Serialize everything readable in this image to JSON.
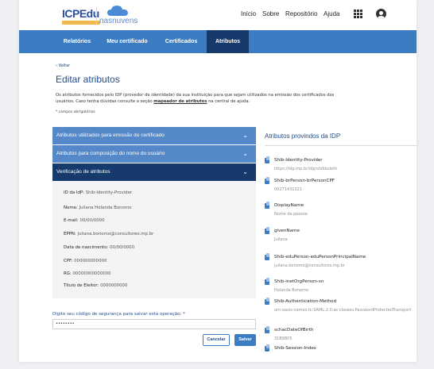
{
  "header": {
    "brand_icp": "ICPEdu",
    "brand_nas": "nasnuvens",
    "nav": [
      "Início",
      "Sobre",
      "Repositório",
      "Ajuda"
    ]
  },
  "mainnav": {
    "tabs": [
      "Relatórios",
      "Meu certificado",
      "Certificados",
      "Atributos"
    ],
    "active": "Atributos"
  },
  "page": {
    "back_label": "Voltar",
    "title": "Editar atributos",
    "intro_1": "Os atributos fornecidos pelo IDP (provedor de identidade) da sua instituição para que sejam utilizados na emissão dos certificados dos",
    "intro_2a": "usuários. Caso tenha dúvidas consulte a seção ",
    "intro_link": "mapeador de atributos",
    "intro_2b": " na central de ajuda.",
    "required_note": "* campos obrigatórios"
  },
  "accordion": {
    "items": [
      "Atributos utilizados para emissão do certificado",
      "Atributos para composição do nome do usuário",
      "Verificação de atributos"
    ],
    "verification": [
      {
        "k": "ID da IdP:",
        "v": "Shib-Identity-Provider"
      },
      {
        "k": "Nome:",
        "v": "Juliana Holanda Bonomo"
      },
      {
        "k": "E-mail:",
        "v": "00/00/0000"
      },
      {
        "k": "EPPN:",
        "v": "juliana.bonomo@consultores.mp.br"
      },
      {
        "k": "Data de nascimento:",
        "v": "00/00/0000"
      },
      {
        "k": "CPF:",
        "v": "000000000000"
      },
      {
        "k": "RG:",
        "v": "00000000000000"
      },
      {
        "k": "Título de Eleitor:",
        "v": "0000000000"
      }
    ]
  },
  "security": {
    "label": "Digite seu código de segurança para salvar esta operação: *",
    "value": "••••••••",
    "cancel": "Cancelar",
    "save": "Salvar"
  },
  "right": {
    "title": "Atributos provindos da IDP",
    "attrs": [
      {
        "name": "Shib-Identity-Provider",
        "value": "https://idp.mp.br/idp/shibboleth"
      },
      {
        "name": "Shib-brPerson-brPersonCPF",
        "value": "00271431121"
      },
      {
        "name": "DisplayName",
        "value": "Nome da pessoa"
      },
      {
        "name": "givenName",
        "value": "Juliana"
      },
      {
        "name": "Shib-eduPerson-eduPersonPrincipalName",
        "value": "juliana.bonomo@consultores.mp.br"
      },
      {
        "name": "Shib-inetOrgPerson-sn",
        "value": "Holanda Bonomo"
      },
      {
        "name": "Shib-Authentication-Method",
        "value": "urn:oasis:names:tc:SAML:2.0:ac:classes:PasswordProtectedTransport"
      },
      {
        "name": "schacDateOfBirth",
        "value": "31B9805"
      },
      {
        "name": "Shib-Session-Index",
        "value": ""
      }
    ]
  },
  "colors": {
    "primary": "#3c7cc3",
    "dark": "#163a6b",
    "accordion": "#5488c8",
    "title": "#1f4e8c"
  }
}
